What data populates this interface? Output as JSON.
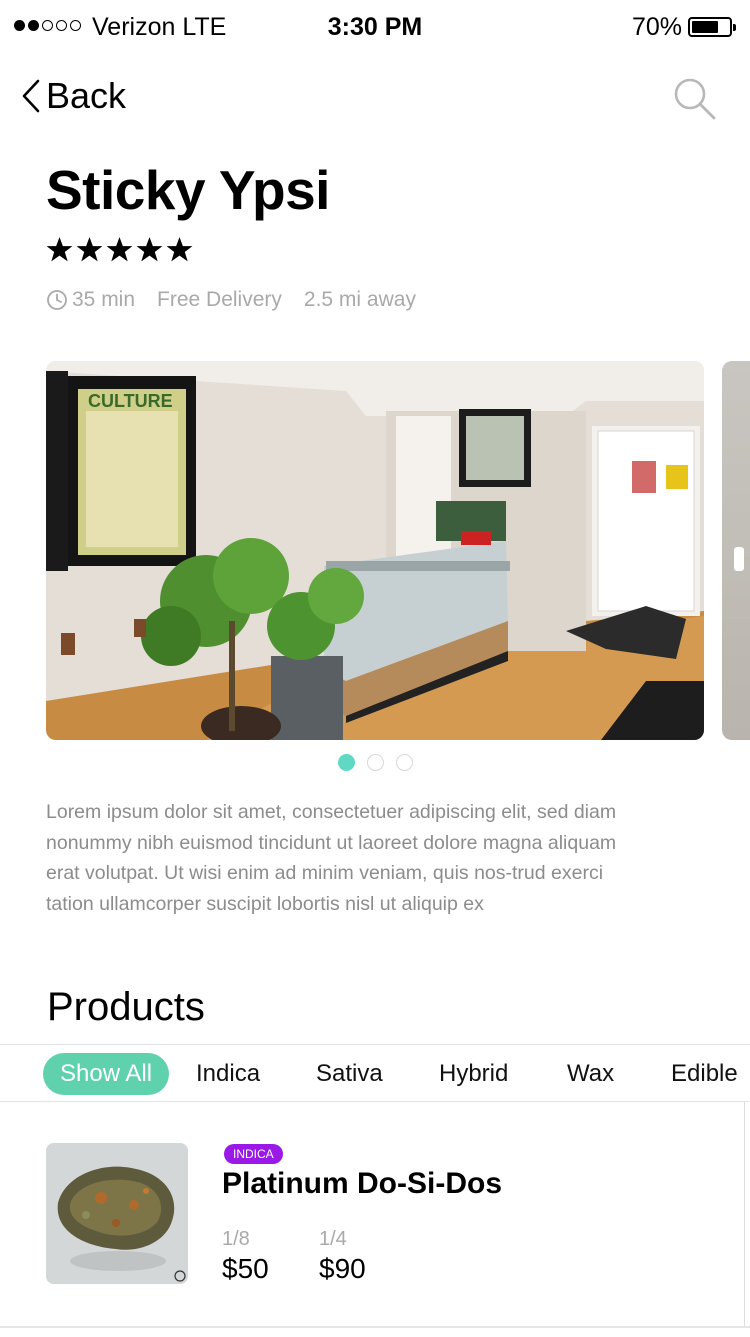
{
  "status_bar": {
    "carrier": "Verizon LTE",
    "time": "3:30 PM",
    "battery": "70%",
    "signal_bars_filled": 2,
    "signal_bars_total": 5,
    "battery_level": 0.7
  },
  "nav": {
    "back_label": "Back",
    "back_icon": "chevron-left-icon",
    "search_icon": "search-icon"
  },
  "store": {
    "name": "Sticky Ypsi",
    "rating": 5,
    "rating_max": 5,
    "delivery_time": "35 min",
    "delivery_fee": "Free Delivery",
    "distance": "2.5 mi away",
    "description": "Lorem ipsum dolor sit amet, consectetuer adipiscing elit, sed diam nonummy nibh euismod tincidunt ut laoreet dolore magna aliquam erat volutpat. Ut wisi enim ad minim veniam, quis nos-trud exerci tation ullamcorper suscipit lobortis nisl ut aliquip ex"
  },
  "carousel": {
    "page_count": 3,
    "active_page": 1
  },
  "products": {
    "title": "Products",
    "filters": [
      "Show All",
      "Indica",
      "Sativa",
      "Hybrid",
      "Wax",
      "Edible"
    ],
    "active_filter": "Show All",
    "items": [
      {
        "badge": "INDICA",
        "name": "Platinum Do-Si-Dos",
        "prices": [
          {
            "size": "1/8",
            "price": "$50"
          },
          {
            "size": "1/4",
            "price": "$90"
          }
        ]
      }
    ]
  },
  "colors": {
    "accent": "#5fd1ac",
    "pager_active": "#5fd9c4",
    "indica_badge": "#9a19e6",
    "muted_text": "#a9a9a9"
  }
}
